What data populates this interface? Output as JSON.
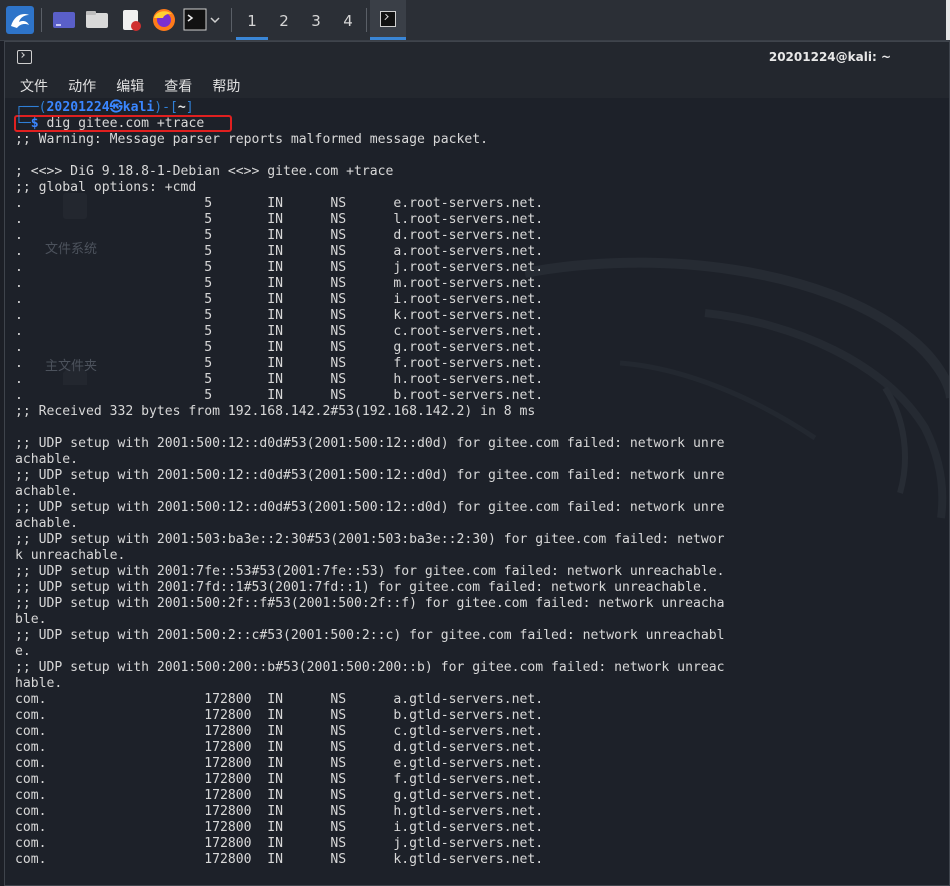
{
  "taskbar": {
    "workspaces": [
      "1",
      "2",
      "3",
      "4"
    ],
    "active_workspace": "1"
  },
  "window": {
    "title": "20201224@kali: ~"
  },
  "menu": [
    "文件",
    "动作",
    "编辑",
    "查看",
    "帮助"
  ],
  "desktop_ghost": {
    "filesystem": "文件系统",
    "home": "主文件夹"
  },
  "terminal": {
    "prompt_top": "┌──(",
    "prompt_user": "20201224㉿kali",
    "prompt_mid": ")-[",
    "prompt_dir": "~",
    "prompt_end": "]",
    "prompt_second": "└─",
    "dollar": "$",
    "command": " dig gitee.com +trace",
    "lines": [
      ";; Warning: Message parser reports malformed message packet.",
      "",
      "; <<>> DiG 9.18.8-1-Debian <<>> gitee.com +trace",
      ";; global options: +cmd",
      ".                       5       IN      NS      e.root-servers.net.",
      ".                       5       IN      NS      l.root-servers.net.",
      ".                       5       IN      NS      d.root-servers.net.",
      ".                       5       IN      NS      a.root-servers.net.",
      ".                       5       IN      NS      j.root-servers.net.",
      ".                       5       IN      NS      m.root-servers.net.",
      ".                       5       IN      NS      i.root-servers.net.",
      ".                       5       IN      NS      k.root-servers.net.",
      ".                       5       IN      NS      c.root-servers.net.",
      ".                       5       IN      NS      g.root-servers.net.",
      ".                       5       IN      NS      f.root-servers.net.",
      ".                       5       IN      NS      h.root-servers.net.",
      ".                       5       IN      NS      b.root-servers.net.",
      ";; Received 332 bytes from 192.168.142.2#53(192.168.142.2) in 8 ms",
      "",
      ";; UDP setup with 2001:500:12::d0d#53(2001:500:12::d0d) for gitee.com failed: network unre",
      "achable.",
      ";; UDP setup with 2001:500:12::d0d#53(2001:500:12::d0d) for gitee.com failed: network unre",
      "achable.",
      ";; UDP setup with 2001:500:12::d0d#53(2001:500:12::d0d) for gitee.com failed: network unre",
      "achable.",
      ";; UDP setup with 2001:503:ba3e::2:30#53(2001:503:ba3e::2:30) for gitee.com failed: networ",
      "k unreachable.",
      ";; UDP setup with 2001:7fe::53#53(2001:7fe::53) for gitee.com failed: network unreachable.",
      ";; UDP setup with 2001:7fd::1#53(2001:7fd::1) for gitee.com failed: network unreachable.",
      ";; UDP setup with 2001:500:2f::f#53(2001:500:2f::f) for gitee.com failed: network unreacha",
      "ble.",
      ";; UDP setup with 2001:500:2::c#53(2001:500:2::c) for gitee.com failed: network unreachabl",
      "e.",
      ";; UDP setup with 2001:500:200::b#53(2001:500:200::b) for gitee.com failed: network unreac",
      "hable.",
      "com.                    172800  IN      NS      a.gtld-servers.net.",
      "com.                    172800  IN      NS      b.gtld-servers.net.",
      "com.                    172800  IN      NS      c.gtld-servers.net.",
      "com.                    172800  IN      NS      d.gtld-servers.net.",
      "com.                    172800  IN      NS      e.gtld-servers.net.",
      "com.                    172800  IN      NS      f.gtld-servers.net.",
      "com.                    172800  IN      NS      g.gtld-servers.net.",
      "com.                    172800  IN      NS      h.gtld-servers.net.",
      "com.                    172800  IN      NS      i.gtld-servers.net.",
      "com.                    172800  IN      NS      j.gtld-servers.net.",
      "com.                    172800  IN      NS      k.gtld-servers.net."
    ]
  }
}
